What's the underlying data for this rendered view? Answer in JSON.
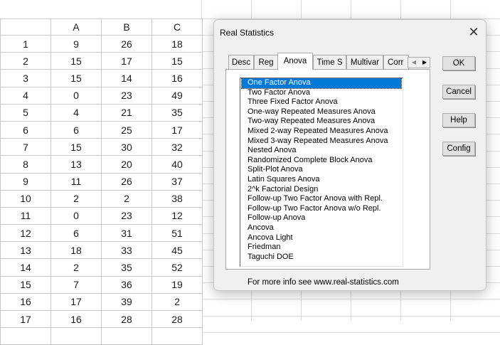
{
  "spreadsheet": {
    "columns": [
      "A",
      "B",
      "C"
    ],
    "rows": [
      {
        "n": "1",
        "a": "9",
        "b": "26",
        "c": "18"
      },
      {
        "n": "2",
        "a": "15",
        "b": "17",
        "c": "15"
      },
      {
        "n": "3",
        "a": "15",
        "b": "14",
        "c": "16"
      },
      {
        "n": "4",
        "a": "0",
        "b": "23",
        "c": "49"
      },
      {
        "n": "5",
        "a": "4",
        "b": "21",
        "c": "35"
      },
      {
        "n": "6",
        "a": "6",
        "b": "25",
        "c": "17"
      },
      {
        "n": "7",
        "a": "15",
        "b": "30",
        "c": "32"
      },
      {
        "n": "8",
        "a": "13",
        "b": "20",
        "c": "40"
      },
      {
        "n": "9",
        "a": "11",
        "b": "26",
        "c": "37"
      },
      {
        "n": "10",
        "a": "2",
        "b": "2",
        "c": "38"
      },
      {
        "n": "11",
        "a": "0",
        "b": "23",
        "c": "12"
      },
      {
        "n": "12",
        "a": "6",
        "b": "31",
        "c": "51"
      },
      {
        "n": "13",
        "a": "18",
        "b": "33",
        "c": "45"
      },
      {
        "n": "14",
        "a": "2",
        "b": "35",
        "c": "52"
      },
      {
        "n": "15",
        "a": "7",
        "b": "36",
        "c": "19"
      },
      {
        "n": "16",
        "a": "17",
        "b": "39",
        "c": "2"
      },
      {
        "n": "17",
        "a": "16",
        "b": "28",
        "c": "28"
      }
    ]
  },
  "dialog": {
    "title": "Real Statistics",
    "close_glyph": "✕",
    "tabs": [
      "Desc",
      "Reg",
      "Anova",
      "Time S",
      "Multivar",
      "Corr"
    ],
    "active_tab": "Anova",
    "scroll_left_glyph": "◀",
    "scroll_right_glyph": "▶",
    "list_items": [
      "One Factor Anova",
      "Two Factor Anova",
      "Three Fixed Factor Anova",
      "One-way Repeated Measures Anova",
      "Two-way Repeated Measures Anova",
      "Mixed 2-way Repeated Measures Anova",
      "Mixed 3-way Repeated Measures Anova",
      "Nested Anova",
      "Randomized Complete Block Anova",
      "Split-Plot Anova",
      "Latin Squares Anova",
      "2^k Factorial Design",
      "Follow-up Two Factor Anova with Repl.",
      "Follow-up Two Factor Anova w/o Repl.",
      "Follow-up Anova",
      "Ancova",
      "Ancova Light",
      "Friedman",
      "Taguchi DOE"
    ],
    "selected_item": "One Factor Anova",
    "buttons": {
      "ok": "OK",
      "cancel": "Cancel",
      "help": "Help",
      "config": "Config"
    },
    "footer": "For more info see www.real-statistics.com"
  },
  "colors": {
    "selection": "#0078d7",
    "dialog_bg": "#f0f0f0",
    "gridline": "#d9d9d9"
  }
}
